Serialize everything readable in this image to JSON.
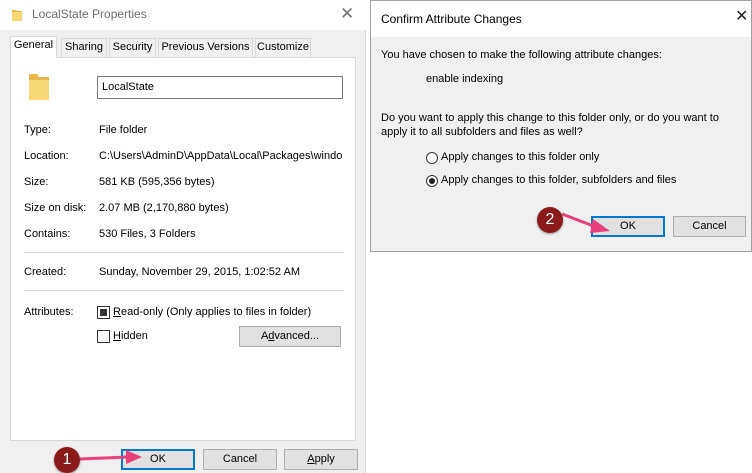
{
  "properties_dialog": {
    "title": "LocalState Properties",
    "close_glyph": "✕",
    "tabs": [
      "General",
      "Sharing",
      "Security",
      "Previous Versions",
      "Customize"
    ],
    "folder_name": "LocalState",
    "fields": {
      "type_label": "Type:",
      "type_value": "File folder",
      "location_label": "Location:",
      "location_value": "C:\\Users\\AdminD\\AppData\\Local\\Packages\\windo",
      "size_label": "Size:",
      "size_value": "581 KB (595,356 bytes)",
      "size_on_disk_label": "Size on disk:",
      "size_on_disk_value": "2.07 MB (2,170,880 bytes)",
      "contains_label": "Contains:",
      "contains_value": "530 Files, 3 Folders",
      "created_label": "Created:",
      "created_value": "Sunday, November 29, 2015, 1:02:52 AM",
      "attributes_label": "Attributes:"
    },
    "attributes": {
      "readonly_label_underlined": "R",
      "readonly_label_rest": "ead-only (Only applies to files in folder)",
      "readonly_state": "indeterminate",
      "hidden_label_underlined": "H",
      "hidden_label_rest": "idden",
      "hidden_state": "unchecked",
      "advanced_pre": "A",
      "advanced_underlined": "d",
      "advanced_post": "vanced..."
    },
    "buttons": {
      "ok": "OK",
      "cancel": "Cancel",
      "apply_underlined": "A",
      "apply_rest": "pply"
    }
  },
  "confirm_dialog": {
    "title": "Confirm Attribute Changes",
    "close_glyph": "✕",
    "intro": "You have chosen to make the following attribute changes:",
    "change": "enable indexing",
    "question_line1": "Do you want to apply this change to this folder only, or do you want to",
    "question_line2": "apply it to all subfolders and files as well?",
    "options": [
      {
        "label": "Apply changes to this folder only",
        "selected": false
      },
      {
        "label": "Apply changes to this folder, subfolders and files",
        "selected": true
      }
    ],
    "buttons": {
      "ok": "OK",
      "cancel": "Cancel"
    }
  },
  "annotations": {
    "step1": "1",
    "step2": "2",
    "marker_color": "#8b1a1a",
    "arrow_color": "#e8407a"
  },
  "colors": {
    "dialog_bg": "#f0f0f0",
    "accent": "#0078d7",
    "folder_yellow": "#f8d775"
  }
}
